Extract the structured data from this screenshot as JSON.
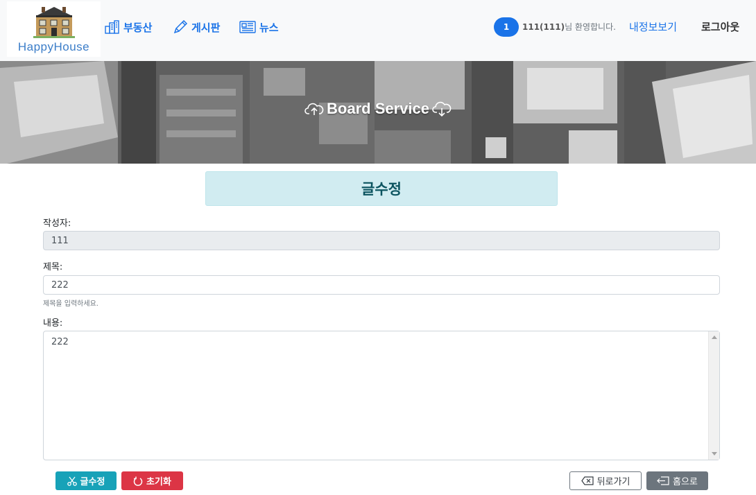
{
  "brand": {
    "logo_text": "HappyHouse"
  },
  "nav": {
    "items": [
      {
        "label": "부동산",
        "icon": "building-icon"
      },
      {
        "label": "게시판",
        "icon": "pencil-icon"
      },
      {
        "label": "뉴스",
        "icon": "newspaper-icon"
      }
    ]
  },
  "user": {
    "badge": "1",
    "welcome_user": "111(111)",
    "welcome_suffix": "님 환영합니다.",
    "mypage_label": "내정보보기",
    "logout_label": "로그아웃"
  },
  "hero": {
    "title": "Board Service"
  },
  "form": {
    "title": "글수정",
    "writer_label": "작성자:",
    "writer_value": "111",
    "subject_label": "제목:",
    "subject_value": "222",
    "subject_help": "제목을 입력하세요.",
    "content_label": "내용:",
    "content_value": "222"
  },
  "buttons": {
    "modify": "글수정",
    "reset": "초기화",
    "back": "뒤로가기",
    "home": "홈으로"
  },
  "colors": {
    "primary": "#1a73e8",
    "info": "#17a2b8",
    "danger": "#dc3545",
    "secondary": "#6c757d",
    "alert_bg": "#d1ecf1"
  }
}
